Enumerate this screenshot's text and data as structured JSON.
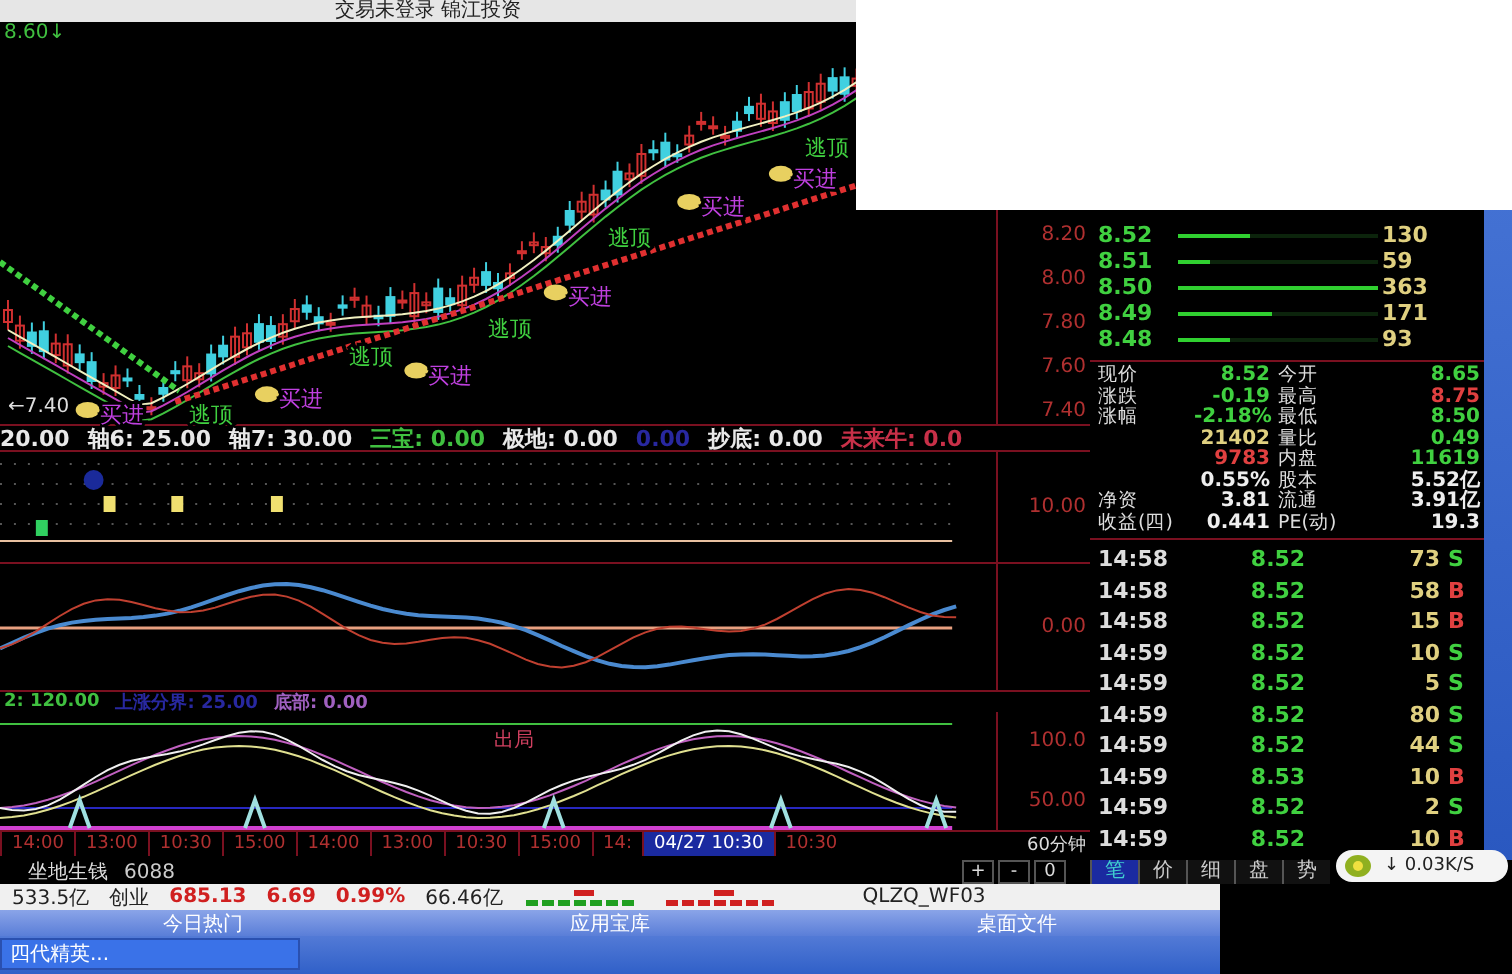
{
  "window": {
    "title": "交易未登录 锦江投资"
  },
  "price_chart": {
    "high_label": "8.60↓",
    "low_label": "←7.40",
    "axis": [
      "8.20",
      "8.00",
      "7.80",
      "7.60",
      "7.40"
    ],
    "signals": [
      {
        "text": "买进",
        "kind": "buy"
      },
      {
        "text": "买进",
        "kind": "buy"
      },
      {
        "text": "买进",
        "kind": "buy"
      },
      {
        "text": "买进",
        "kind": "buy"
      },
      {
        "text": "买进",
        "kind": "buy"
      },
      {
        "text": "买进",
        "kind": "buy"
      },
      {
        "text": "逃顶",
        "kind": "sell"
      },
      {
        "text": "逃顶",
        "kind": "sell"
      },
      {
        "text": "逃顶",
        "kind": "sell"
      },
      {
        "text": "逃顶",
        "kind": "sell"
      },
      {
        "text": "逃顶",
        "kind": "sell"
      }
    ]
  },
  "indicator_legend": [
    {
      "text": "20.00",
      "color": "#e8e8e8"
    },
    {
      "text": "轴6: 25.00",
      "color": "#e8e8e8"
    },
    {
      "text": "轴7: 30.00",
      "color": "#e8e8e8"
    },
    {
      "text": "三宝: 0.00",
      "color": "#40c040"
    },
    {
      "text": "极地: 0.00",
      "color": "#e8e8e8"
    },
    {
      "text": "0.00",
      "color": "#2828a0"
    },
    {
      "text": "抄底: 0.00",
      "color": "#e8e8e8"
    },
    {
      "text": "未来牛: 0.0",
      "color": "#c83048"
    }
  ],
  "dots_panel": {
    "axis": [
      "10.00"
    ]
  },
  "macd_panel": {
    "axis": [
      "0.00"
    ]
  },
  "kdj_legend": [
    {
      "text": "2: 120.00",
      "color": "#40c040"
    },
    {
      "text": "上涨分界: 25.00",
      "color": "#2828a0"
    },
    {
      "text": "底部: 0.00",
      "color": "#a060c0"
    }
  ],
  "kdj_panel": {
    "label": "出局",
    "axis": [
      "100.0",
      "50.00"
    ]
  },
  "time_axis": {
    "ticks": [
      {
        "text": "14:00",
        "selected": false
      },
      {
        "text": "13:00",
        "selected": false
      },
      {
        "text": "10:30",
        "selected": false
      },
      {
        "text": "15:00",
        "selected": false
      },
      {
        "text": "14:00",
        "selected": false
      },
      {
        "text": "13:00",
        "selected": false
      },
      {
        "text": "10:30",
        "selected": false
      },
      {
        "text": "15:00",
        "selected": false
      },
      {
        "text": "14:",
        "selected": false
      },
      {
        "text": "04/27 10:30",
        "selected": true
      },
      {
        "text": "10:30",
        "selected": false
      }
    ],
    "period": "60分钟"
  },
  "order_book": [
    {
      "price": "8.52",
      "volume": "130",
      "level": 0.36
    },
    {
      "price": "8.51",
      "volume": "59",
      "level": 0.16
    },
    {
      "price": "8.50",
      "volume": "363",
      "level": 1
    },
    {
      "price": "8.49",
      "volume": "171",
      "level": 0.47
    },
    {
      "price": "8.48",
      "volume": "93",
      "level": 0.26
    }
  ],
  "quote": [
    {
      "label": "现价",
      "value": "8.52",
      "color": "#40d040"
    },
    {
      "label": "今开",
      "value": "8.65",
      "color": "#40d040"
    },
    {
      "label": "涨跌",
      "value": "-0.19",
      "color": "#40d040"
    },
    {
      "label": "最高",
      "value": "8.75",
      "color": "#e04040"
    },
    {
      "label": "涨幅",
      "value": "-2.18%",
      "color": "#40d040"
    },
    {
      "label": "最低",
      "value": "8.50",
      "color": "#40d040"
    },
    {
      "value": "21402",
      "color": "#e0d080"
    },
    {
      "label": "量比",
      "value": "0.49",
      "color": "#40d040"
    },
    {
      "value": "9783",
      "color": "#e04040"
    },
    {
      "label": "内盘",
      "value": "11619",
      "color": "#40d040"
    },
    {
      "value": "0.55%",
      "color": "#eeeeee"
    },
    {
      "label": "股本",
      "value": "5.52亿",
      "color": "#eeeeee"
    },
    {
      "label": "净资",
      "value": "3.81",
      "color": "#eeeeee"
    },
    {
      "label": "流通",
      "value": "3.91亿",
      "color": "#eeeeee"
    },
    {
      "label": "收益(四)",
      "value": "0.441",
      "color": "#eeeeee"
    },
    {
      "label": "PE(动)",
      "value": "19.3",
      "color": "#eeeeee"
    }
  ],
  "ticks": [
    {
      "time": "14:58",
      "price": "8.52",
      "volume": "73",
      "side": "S"
    },
    {
      "time": "14:58",
      "price": "8.52",
      "volume": "58",
      "side": "B"
    },
    {
      "time": "14:58",
      "price": "8.52",
      "volume": "15",
      "side": "B"
    },
    {
      "time": "14:59",
      "price": "8.52",
      "volume": "10",
      "side": "S"
    },
    {
      "time": "14:59",
      "price": "8.52",
      "volume": "5",
      "side": "S"
    },
    {
      "time": "14:59",
      "price": "8.52",
      "volume": "80",
      "side": "S"
    },
    {
      "time": "14:59",
      "price": "8.52",
      "volume": "44",
      "side": "S"
    },
    {
      "time": "14:59",
      "price": "8.53",
      "volume": "10",
      "side": "B"
    },
    {
      "time": "14:59",
      "price": "8.52",
      "volume": "2",
      "side": "S"
    },
    {
      "time": "14:59",
      "price": "8.52",
      "volume": "10",
      "side": "B"
    }
  ],
  "bottom_bar": {
    "name": "坐地生钱",
    "code": "6088",
    "controls": [
      "+",
      "-",
      "0"
    ],
    "tabs": [
      {
        "label": "笔",
        "selected": true
      },
      {
        "label": "价",
        "selected": false
      },
      {
        "label": "细",
        "selected": false
      },
      {
        "label": "盘",
        "selected": false
      },
      {
        "label": "势",
        "selected": false
      }
    ]
  },
  "network_speed": "↓ 0.03K/S",
  "status_bar": {
    "amount": "533.5亿",
    "index_name": "创业",
    "index_value": "685.13",
    "change": "6.69",
    "change_pct": "0.99%",
    "turnover": "66.46亿",
    "account": "QLZQ_WF03"
  },
  "taskbar": {
    "groups": [
      "今日热门",
      "应用宝库",
      "桌面文件"
    ],
    "task": "四代精英..."
  }
}
